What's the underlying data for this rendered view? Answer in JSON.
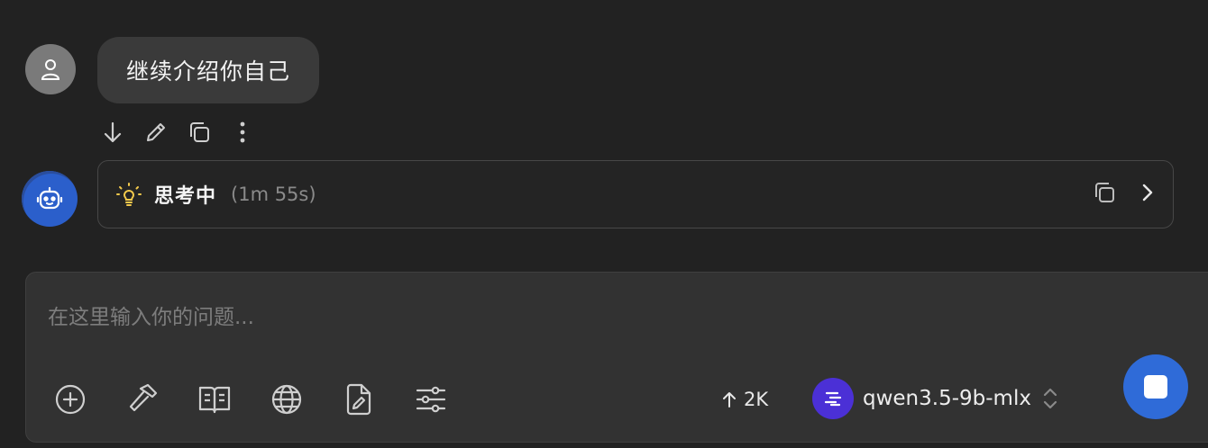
{
  "user_message": {
    "text": "继续介绍你自己"
  },
  "message_actions": [
    {
      "icon": "arrow-down-icon"
    },
    {
      "icon": "pencil-icon"
    },
    {
      "icon": "copy-icon"
    },
    {
      "icon": "more-vertical-icon"
    }
  ],
  "thinking": {
    "title": "思考中",
    "elapsed": "(1m 55s)",
    "icon": "lightbulb-icon",
    "icon_color": "#f2c94c"
  },
  "composer": {
    "placeholder": "在这里输入你的问题...",
    "value": "",
    "tools": [
      "add-icon",
      "hammer-icon",
      "book-icon",
      "globe-icon",
      "file-edit-icon",
      "sliders-icon"
    ],
    "tokens": "2K",
    "model_name": "qwen3.5-9b-mlx"
  },
  "colors": {
    "background": "#222222",
    "accent": "#2f6bd8",
    "model_logo": "#4b30d6"
  }
}
